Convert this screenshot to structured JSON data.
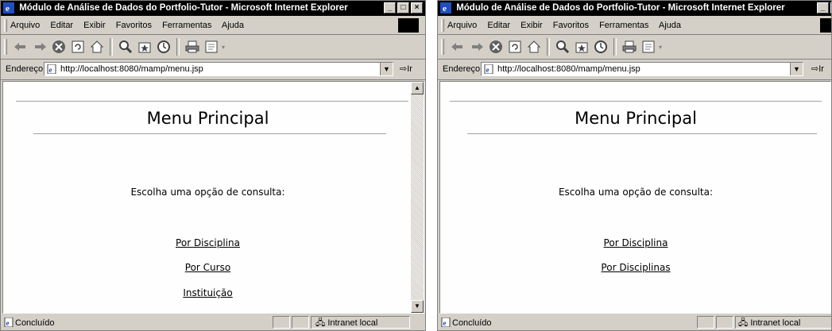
{
  "window": {
    "title": "Módulo de Análise de Dados do Portfolio-Tutor - Microsoft Internet Explorer",
    "buttons": {
      "minimize": "_",
      "maximize": "□",
      "close": "×"
    }
  },
  "menubar": {
    "items": [
      {
        "label": "Arquivo"
      },
      {
        "label": "Editar"
      },
      {
        "label": "Exibir"
      },
      {
        "label": "Favoritos"
      },
      {
        "label": "Ferramentas"
      },
      {
        "label": "Ajuda"
      }
    ]
  },
  "toolbar": {
    "icons": [
      "back-icon",
      "forward-icon",
      "stop-icon",
      "refresh-icon",
      "home-icon",
      "search-icon",
      "favorites-icon",
      "history-icon",
      "print-icon",
      "edit-icon"
    ]
  },
  "address": {
    "label": "Endereço",
    "url": "http://localhost:8080/mamp/menu.jsp",
    "go": "Ir"
  },
  "page": {
    "title": "Menu Principal",
    "prompt": "Escolha uma opção de consulta:"
  },
  "windows": [
    {
      "links": [
        {
          "label": "Por Disciplina"
        },
        {
          "label": "Por Curso"
        },
        {
          "label": "Instituição"
        }
      ]
    },
    {
      "links": [
        {
          "label": "Por Disciplina"
        },
        {
          "label": "Por Disciplinas"
        }
      ]
    }
  ],
  "status": {
    "text": "Concluído",
    "zone": "Intranet local"
  }
}
